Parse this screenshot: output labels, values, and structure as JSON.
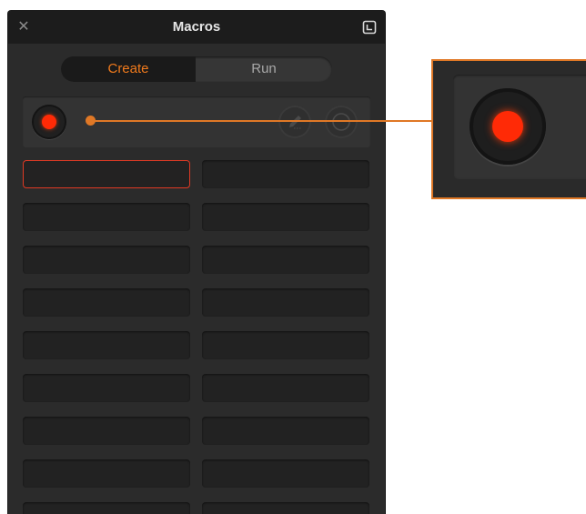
{
  "window": {
    "title": "Macros",
    "close_icon": "close-icon",
    "dock_icon": "dock-window-icon"
  },
  "tabs": [
    {
      "label": "Create",
      "active": true
    },
    {
      "label": "Run",
      "active": false
    }
  ],
  "colors": {
    "accent": "#f07a1c",
    "record": "#ff2a06",
    "callout": "#e07826",
    "selected_outline": "#e03a24"
  },
  "record_bar": {
    "record_icon": "record-icon",
    "edit_icon": "pencil-icon",
    "stop_icon": "stop-circle-icon"
  },
  "macro_slots": {
    "rows": 9,
    "columns": 2,
    "selected_index": 0,
    "labels": [
      "",
      "",
      "",
      "",
      "",
      "",
      "",
      "",
      "",
      "",
      "",
      "",
      "",
      "",
      "",
      "",
      "",
      ""
    ]
  },
  "callout": {
    "subject": "record-button"
  }
}
